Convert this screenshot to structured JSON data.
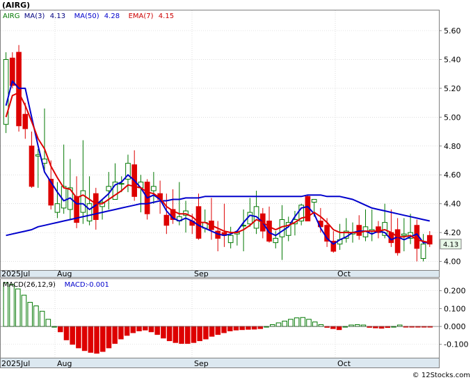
{
  "chart_data": [
    {
      "type": "candlestick",
      "title": "(AIRG)",
      "legend": [
        {
          "label": "AIRG",
          "color": "#007700"
        },
        {
          "label": "MA(3)",
          "value": "4.13",
          "color": "#000080"
        },
        {
          "label": "MA(50)",
          "value": "4.28",
          "color": "#0000cc"
        },
        {
          "label": "EMA(7)",
          "value": "4.15",
          "color": "#cc0000"
        }
      ],
      "legend_position": "top-left",
      "x_tick_labels": [
        "2025Jul",
        "Aug",
        "Sep",
        "Oct"
      ],
      "y_tick_labels": [
        "4.00",
        "4.20",
        "4.40",
        "4.60",
        "4.80",
        "5.00",
        "5.20",
        "5.40",
        "5.60"
      ],
      "ylim": [
        3.94,
        5.74
      ],
      "grid": true,
      "last_price_label": "4.13",
      "colors": {
        "up": "#007700",
        "down": "#dd0000",
        "ma": "#0000cc",
        "ema": "#dd0000",
        "grid": "#c8c8c8",
        "axis_band": "#dce8f0"
      },
      "candles": [
        [
          4.95,
          5.45,
          4.89,
          5.4
        ],
        [
          5.41,
          5.45,
          5.2,
          5.22
        ],
        [
          5.45,
          5.5,
          4.9,
          4.94
        ],
        [
          5.02,
          5.1,
          4.85,
          4.92
        ],
        [
          4.8,
          4.9,
          4.51,
          4.52
        ],
        [
          4.73,
          4.78,
          4.51,
          4.74
        ],
        [
          4.68,
          5.06,
          4.62,
          4.71
        ],
        [
          4.57,
          4.7,
          4.36,
          4.39
        ],
        [
          4.34,
          4.55,
          4.3,
          4.4
        ],
        [
          4.37,
          4.81,
          4.33,
          4.52
        ],
        [
          4.36,
          4.71,
          4.29,
          4.51
        ],
        [
          4.45,
          4.59,
          4.23,
          4.27
        ],
        [
          4.34,
          4.84,
          4.26,
          4.49
        ],
        [
          4.28,
          4.59,
          4.25,
          4.4
        ],
        [
          4.47,
          4.51,
          4.22,
          4.29
        ],
        [
          4.38,
          4.43,
          4.29,
          4.41
        ],
        [
          4.49,
          4.62,
          4.36,
          4.52
        ],
        [
          4.43,
          4.68,
          4.45,
          4.55
        ],
        [
          4.54,
          4.59,
          4.48,
          4.54
        ],
        [
          4.57,
          4.74,
          4.48,
          4.68
        ],
        [
          4.67,
          4.77,
          4.42,
          4.45
        ],
        [
          4.51,
          4.6,
          4.34,
          4.55
        ],
        [
          4.55,
          4.57,
          4.29,
          4.33
        ],
        [
          4.49,
          4.62,
          4.4,
          4.52
        ],
        [
          4.47,
          4.56,
          4.33,
          4.43
        ],
        [
          4.32,
          4.47,
          4.19,
          4.25
        ],
        [
          4.36,
          4.5,
          4.26,
          4.29
        ],
        [
          4.28,
          4.55,
          4.25,
          4.31
        ],
        [
          4.32,
          4.42,
          4.2,
          4.35
        ],
        [
          4.28,
          4.33,
          4.19,
          4.25
        ],
        [
          4.38,
          4.47,
          4.15,
          4.16
        ],
        [
          4.23,
          4.36,
          4.2,
          4.27
        ],
        [
          4.28,
          4.44,
          4.15,
          4.22
        ],
        [
          4.21,
          4.28,
          4.07,
          4.16
        ],
        [
          4.2,
          4.4,
          4.1,
          4.18
        ],
        [
          4.13,
          4.24,
          4.09,
          4.18
        ],
        [
          4.19,
          4.21,
          4.11,
          4.2
        ],
        [
          4.25,
          4.36,
          4.07,
          4.25
        ],
        [
          4.26,
          4.44,
          4.24,
          4.34
        ],
        [
          4.23,
          4.49,
          4.19,
          4.38
        ],
        [
          4.33,
          4.37,
          4.16,
          4.21
        ],
        [
          4.28,
          4.38,
          4.13,
          4.14
        ],
        [
          4.13,
          4.21,
          4.09,
          4.16
        ],
        [
          4.17,
          4.39,
          4.01,
          4.29
        ],
        [
          4.18,
          4.31,
          4.14,
          4.27
        ],
        [
          4.26,
          4.35,
          4.18,
          4.29
        ],
        [
          4.28,
          4.4,
          4.25,
          4.39
        ],
        [
          4.45,
          4.46,
          4.28,
          4.28
        ],
        [
          4.41,
          4.42,
          4.31,
          4.43
        ],
        [
          4.28,
          4.37,
          4.2,
          4.24
        ],
        [
          4.25,
          4.3,
          4.1,
          4.14
        ],
        [
          4.14,
          4.21,
          4.06,
          4.07
        ],
        [
          4.12,
          4.26,
          4.08,
          4.15
        ],
        [
          4.16,
          4.3,
          4.13,
          4.21
        ],
        [
          4.19,
          4.27,
          4.13,
          4.2
        ],
        [
          4.25,
          4.32,
          4.15,
          4.18
        ],
        [
          4.17,
          4.36,
          4.14,
          4.24
        ],
        [
          4.21,
          4.36,
          4.14,
          4.22
        ],
        [
          4.24,
          4.28,
          4.16,
          4.2
        ],
        [
          4.18,
          4.4,
          4.16,
          4.27
        ],
        [
          4.2,
          4.36,
          4.1,
          4.13
        ],
        [
          4.22,
          4.3,
          4.04,
          4.06
        ],
        [
          4.18,
          4.3,
          4.07,
          4.19
        ],
        [
          4.16,
          4.33,
          4.12,
          4.2
        ],
        [
          4.25,
          4.29,
          4.0,
          4.09
        ],
        [
          4.02,
          4.19,
          4.0,
          4.12
        ],
        [
          4.18,
          4.21,
          4.1,
          4.12
        ]
      ],
      "ma50": [
        4.18,
        4.19,
        4.2,
        4.21,
        4.22,
        4.24,
        4.25,
        4.26,
        4.27,
        4.28,
        4.29,
        4.3,
        4.31,
        4.32,
        4.33,
        4.34,
        4.35,
        4.36,
        4.37,
        4.38,
        4.39,
        4.4,
        4.4,
        4.41,
        4.42,
        4.42,
        4.43,
        4.43,
        4.44,
        4.44,
        4.44,
        4.45,
        4.45,
        4.45,
        4.45,
        4.45,
        4.45,
        4.45,
        4.45,
        4.45,
        4.45,
        4.45,
        4.45,
        4.45,
        4.45,
        4.45,
        4.45,
        4.46,
        4.46,
        4.46,
        4.45,
        4.45,
        4.45,
        4.44,
        4.43,
        4.41,
        4.39,
        4.37,
        4.36,
        4.35,
        4.34,
        4.33,
        4.32,
        4.31,
        4.3,
        4.29,
        4.28
      ],
      "ma50_start": 0,
      "ma3": [
        5.08,
        5.25,
        5.2,
        5.2,
        5.0,
        4.8,
        4.62,
        4.55,
        4.48,
        4.42,
        4.44,
        4.4,
        4.4,
        4.36,
        4.39,
        4.43,
        4.47,
        4.53,
        4.55,
        4.6,
        4.56,
        4.51,
        4.44,
        4.46,
        4.43,
        4.35,
        4.3,
        4.28,
        4.3,
        4.28,
        4.25,
        4.23,
        4.21,
        4.19,
        4.18,
        4.19,
        4.21,
        4.27,
        4.32,
        4.31,
        4.27,
        4.2,
        4.18,
        4.21,
        4.24,
        4.31,
        4.37,
        4.38,
        4.33,
        4.23,
        4.16,
        4.12,
        4.15,
        4.17,
        4.2,
        4.21,
        4.21,
        4.19,
        4.21,
        4.2,
        4.15,
        4.17,
        4.15,
        4.17,
        4.19,
        4.13,
        4.13
      ],
      "ema7": [
        5.0,
        5.15,
        5.17,
        5.08,
        4.97,
        4.85,
        4.78,
        4.66,
        4.58,
        4.51,
        4.5,
        4.44,
        4.46,
        4.43,
        4.4,
        4.4,
        4.43,
        4.46,
        4.49,
        4.53,
        4.52,
        4.51,
        4.48,
        4.47,
        4.44,
        4.38,
        4.35,
        4.33,
        4.33,
        4.31,
        4.27,
        4.27,
        4.25,
        4.23,
        4.21,
        4.2,
        4.2,
        4.22,
        4.25,
        4.29,
        4.27,
        4.24,
        4.22,
        4.24,
        4.25,
        4.27,
        4.3,
        4.31,
        4.34,
        4.31,
        4.27,
        4.22,
        4.2,
        4.2,
        4.2,
        4.2,
        4.21,
        4.21,
        4.21,
        4.22,
        4.2,
        4.17,
        4.17,
        4.18,
        4.15,
        4.14,
        4.13
      ]
    },
    {
      "type": "bar",
      "title": "MACD(26,12,9)",
      "legend": [
        {
          "label": "MACD(26,12,9)"
        },
        {
          "label": "MACD:",
          "value": "-0.001",
          "color": "#0000cc"
        }
      ],
      "x_tick_labels": [
        "2025Jul",
        "Aug",
        "Sep",
        "Oct"
      ],
      "y_tick_labels": [
        "0.200",
        "0.100",
        "0.000",
        "-0.100"
      ],
      "ylim": [
        -0.175,
        0.265
      ],
      "grid": true,
      "values": [
        0.245,
        0.235,
        0.21,
        0.175,
        0.135,
        0.115,
        0.085,
        0.04,
        0.0,
        -0.03,
        -0.075,
        -0.1,
        -0.12,
        -0.135,
        -0.145,
        -0.15,
        -0.14,
        -0.12,
        -0.095,
        -0.07,
        -0.05,
        -0.035,
        -0.025,
        -0.02,
        -0.03,
        -0.045,
        -0.065,
        -0.08,
        -0.09,
        -0.095,
        -0.095,
        -0.09,
        -0.08,
        -0.07,
        -0.055,
        -0.045,
        -0.035,
        -0.025,
        -0.02,
        -0.018,
        -0.016,
        -0.015,
        -0.012,
        0.0,
        0.01,
        0.02,
        0.03,
        0.04,
        0.048,
        0.05,
        0.04,
        0.025,
        0.01,
        -0.005,
        -0.012,
        -0.018,
        0.0,
        0.008,
        0.01,
        0.008,
        -0.005,
        -0.008,
        -0.01,
        -0.006,
        0.0,
        0.008,
        -0.002,
        -0.003,
        -0.003,
        -0.002,
        -0.001
      ]
    }
  ],
  "watermark": "© 12Stocks.com"
}
